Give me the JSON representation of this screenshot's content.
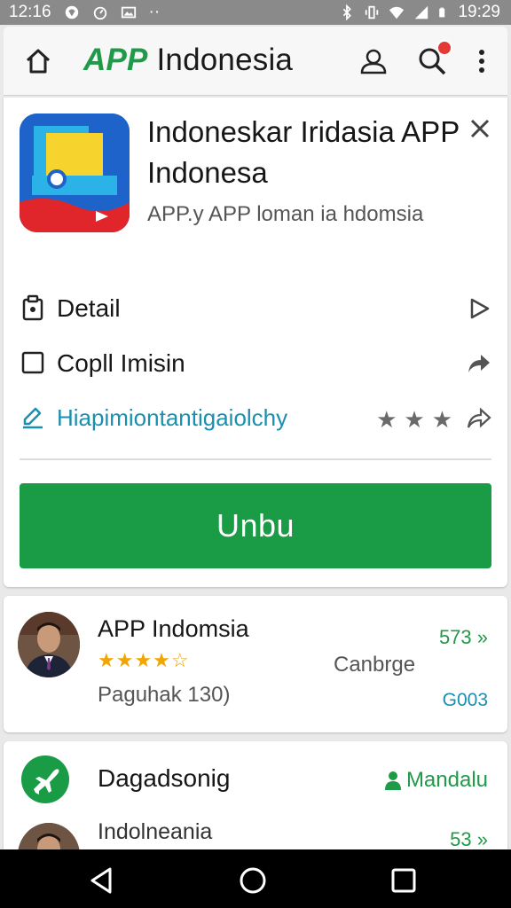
{
  "status_bar": {
    "time_left": "12:16",
    "time_right": "19:29",
    "icons_left": [
      "location-icon",
      "timer-icon",
      "image-icon",
      "more-dots-icon"
    ],
    "icons_right": [
      "bluetooth-icon",
      "vibrate-icon",
      "wifi-icon",
      "signal-icon",
      "battery-icon"
    ]
  },
  "app_bar": {
    "brand": "APP",
    "title_rest": " Indonesia",
    "icons": [
      "home-icon",
      "account-icon",
      "search-icon",
      "overflow-menu-icon"
    ]
  },
  "app_detail": {
    "name": "Indoneskar Iridasia APP Indonesa",
    "subtitle": "APP.y APP loman ia hdomsia",
    "rows": [
      {
        "label": "Detail",
        "icon": "clipboard-icon",
        "action_icon": "play-icon"
      },
      {
        "label": "Copll Imisin",
        "icon": "checkbox-icon",
        "action_icon": "share-icon"
      },
      {
        "label": "Hiapimiontantigaiolchy",
        "icon": "edit-icon",
        "action_icon": "share-icon",
        "stars": 3
      }
    ],
    "cta_label": "Unbu"
  },
  "list": [
    {
      "title": "APP Indomsia",
      "rating": 4.5,
      "stars_text": "★★★★☆",
      "subtitle": "Paguhak 130)",
      "middle": "Canbrge",
      "value": "573 »",
      "code": "G003"
    },
    {
      "title": "Dagadsonig",
      "right_label": "Mandalu",
      "subtitle": "Indolneania",
      "value": "53 »"
    }
  ],
  "colors": {
    "accent_green": "#1a9c46",
    "link_blue": "#1a8fb0",
    "star_gold": "#f0a500",
    "status_gray": "#8a8a8a"
  }
}
